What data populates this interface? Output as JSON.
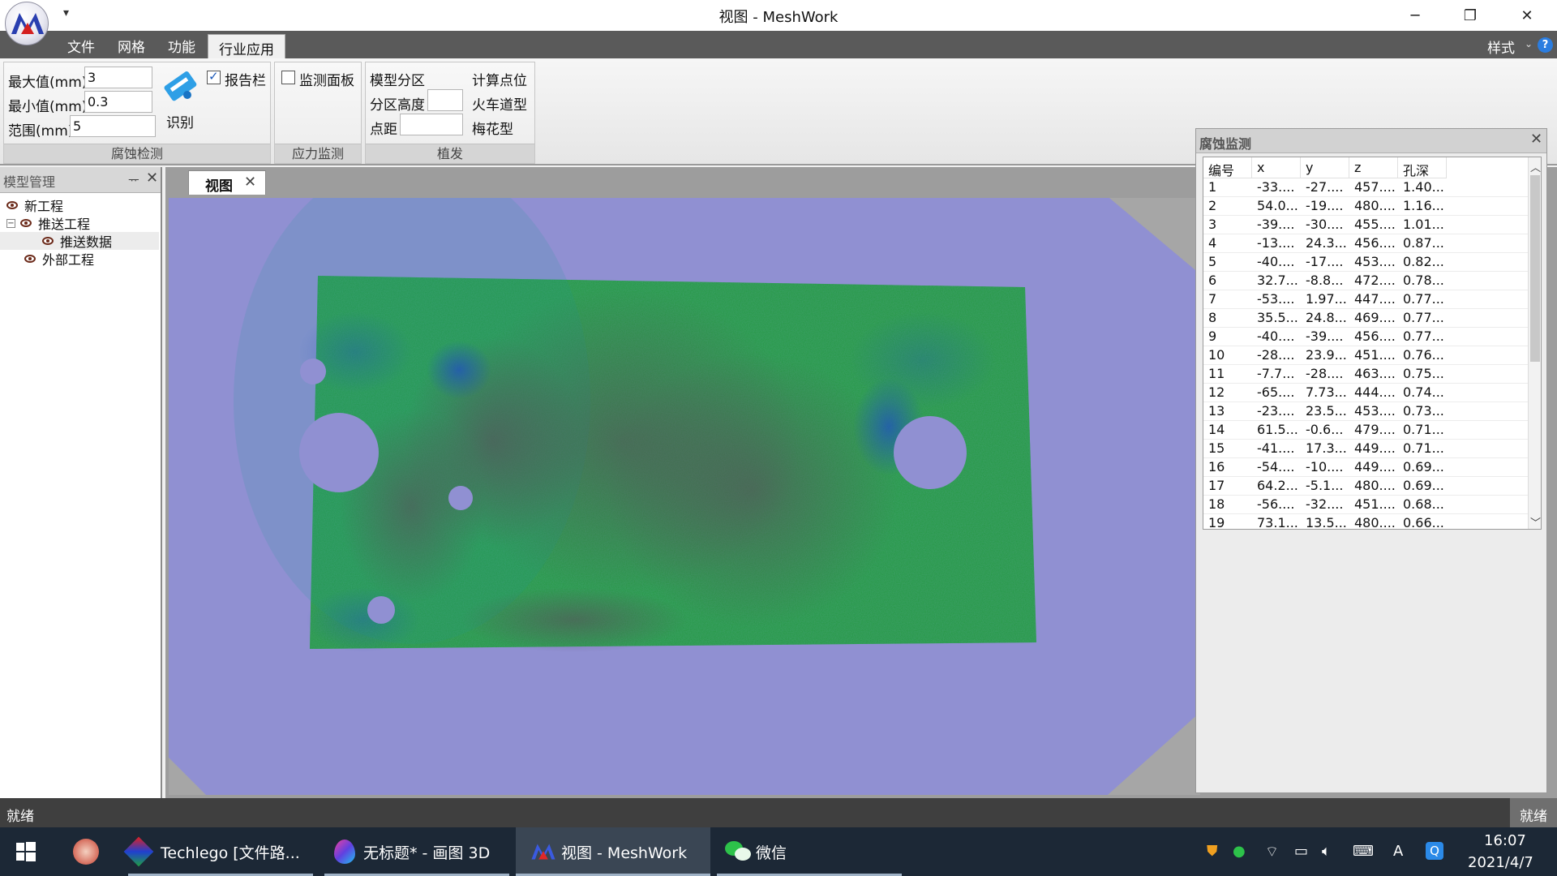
{
  "window": {
    "title": "视图 - MeshWork"
  },
  "menu": {
    "items": [
      "文件",
      "网格",
      "功能"
    ],
    "active": "行业应用",
    "style": "样式",
    "help": "?"
  },
  "ribbon": {
    "corrosion": {
      "max_label": "最大值(mm)",
      "max_value": "3",
      "min_label": "最小值(mm)",
      "min_value": "0.3",
      "range_label": "范围(mm)",
      "range_value": "5",
      "identify": "识别",
      "report_bar": "报告栏",
      "caption": "腐蚀检测"
    },
    "stress": {
      "panel": "监测面板",
      "caption": "应力监测"
    },
    "planting": {
      "partition": "模型分区",
      "partition_height": "分区高度",
      "point_distance": "点距",
      "calc_points": "计算点位",
      "train_track": "火车道型",
      "quincunx": "梅花型",
      "caption": "植发"
    }
  },
  "left_panel": {
    "title": "模型管理",
    "pin": "ᅲ",
    "tree": [
      "新工程",
      "推送工程",
      "推送数据",
      "外部工程"
    ]
  },
  "doc": {
    "tab": "视图"
  },
  "right_panel": {
    "title": "腐蚀监测",
    "columns": [
      "编号",
      "x",
      "y",
      "z",
      "孔深"
    ],
    "rows": [
      [
        "1",
        "-33....",
        "-27....",
        "457....",
        "1.40..."
      ],
      [
        "2",
        "54.0...",
        "-19....",
        "480....",
        "1.16..."
      ],
      [
        "3",
        "-39....",
        "-30....",
        "455....",
        "1.01..."
      ],
      [
        "4",
        "-13....",
        "24.3...",
        "456....",
        "0.87..."
      ],
      [
        "5",
        "-40....",
        "-17....",
        "453....",
        "0.82..."
      ],
      [
        "6",
        "32.7...",
        "-8.8...",
        "472....",
        "0.78..."
      ],
      [
        "7",
        "-53....",
        "1.97...",
        "447....",
        "0.77..."
      ],
      [
        "8",
        "35.5...",
        "24.8...",
        "469....",
        "0.77..."
      ],
      [
        "9",
        "-40....",
        "-39....",
        "456....",
        "0.77..."
      ],
      [
        "10",
        "-28....",
        "23.9...",
        "451....",
        "0.76..."
      ],
      [
        "11",
        "-7.7...",
        "-28....",
        "463....",
        "0.75..."
      ],
      [
        "12",
        "-65....",
        "7.73...",
        "444....",
        "0.74..."
      ],
      [
        "13",
        "-23....",
        "23.5...",
        "453....",
        "0.73..."
      ],
      [
        "14",
        "61.5...",
        "-0.6...",
        "479....",
        "0.71..."
      ],
      [
        "15",
        "-41....",
        "17.3...",
        "449....",
        "0.71..."
      ],
      [
        "16",
        "-54....",
        "-10....",
        "449....",
        "0.69..."
      ],
      [
        "17",
        "64.2...",
        "-5.1...",
        "480....",
        "0.69..."
      ],
      [
        "18",
        "-56....",
        "-32....",
        "451....",
        "0.68..."
      ],
      [
        "19",
        "73.1...",
        "13.5...",
        "480....",
        "0.66..."
      ]
    ]
  },
  "status": {
    "left": "就绪",
    "right": "就绪"
  },
  "taskbar": {
    "items": [
      "Techlego [文件路...",
      "无标题* - 画图 3D",
      "视图 - MeshWork",
      "微信"
    ],
    "time": "16:07",
    "date": "2021/4/7",
    "ime": "A"
  },
  "colors": {
    "viewport": "#9090d2",
    "plate": "#2a9a4a",
    "accent": "#2b7de0"
  }
}
